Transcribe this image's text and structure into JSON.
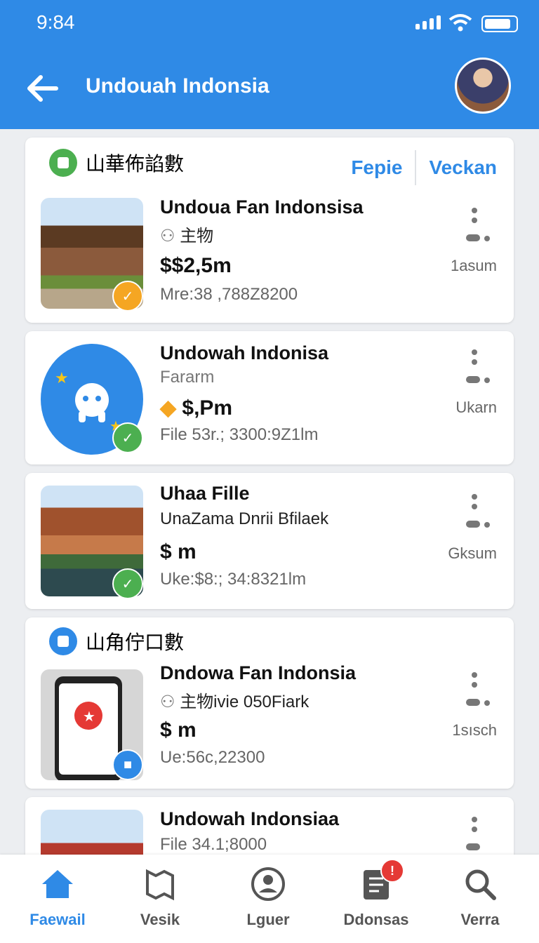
{
  "status_bar": {
    "time": "9:84"
  },
  "app_bar": {
    "title": "Undouah Indonsia"
  },
  "header": {
    "section_label": "山華佈諂數",
    "tab_1": "Fepie",
    "tab_2": "Veckan"
  },
  "listings": [
    {
      "name": "Undoua Fan Indonsisa",
      "subtitle": "主物",
      "price": "$$2,5m",
      "meta": "Mre:38 ,788Z8200",
      "distance": "1asum"
    },
    {
      "name": "Undowah Indonisa",
      "subtitle": "Fararm",
      "price": "$,Pm",
      "meta": "File 53r.; 3300:9Z1lm",
      "distance": "Ukarn"
    },
    {
      "name": "Uhaa Fille",
      "subtitle": "UnaZama Dnrii Bfilaek",
      "price": "$ m",
      "meta": "Uke:$8:; 34:8321lm",
      "distance": "Gksum"
    },
    {
      "name": "Dndowa Fan Indonsia",
      "subtitle": "主物ivie 050Fiark",
      "price": "$ m",
      "meta": "Ue:56c,22300",
      "distance": "1sısch"
    },
    {
      "name": "Undowah Indonsiaa",
      "meta": "File 34.1;8000"
    }
  ],
  "section_2": {
    "label": "山角佇口數"
  },
  "bottom_nav": [
    {
      "label": "Faewail",
      "icon": "home-icon"
    },
    {
      "label": "Vesik",
      "icon": "map-icon"
    },
    {
      "label": "Lguer",
      "icon": "user-icon"
    },
    {
      "label": "Ddonsas",
      "icon": "document-icon",
      "badge": "!"
    },
    {
      "label": "Verra",
      "icon": "search-icon"
    }
  ],
  "colors": {
    "primary": "#2f8ae6",
    "green": "#4caf50",
    "orange": "#f5a623"
  }
}
